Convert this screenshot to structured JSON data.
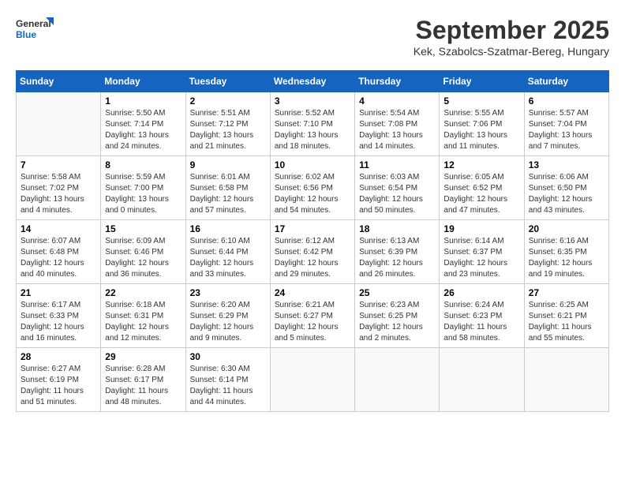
{
  "header": {
    "logo": {
      "general": "General",
      "blue": "Blue"
    },
    "title": "September 2025",
    "location": "Kek, Szabolcs-Szatmar-Bereg, Hungary"
  },
  "calendar": {
    "weekdays": [
      "Sunday",
      "Monday",
      "Tuesday",
      "Wednesday",
      "Thursday",
      "Friday",
      "Saturday"
    ],
    "rows": [
      [
        {
          "day": "",
          "empty": true
        },
        {
          "day": "1",
          "sunrise": "5:50 AM",
          "sunset": "7:14 PM",
          "daylight": "13 hours and 24 minutes."
        },
        {
          "day": "2",
          "sunrise": "5:51 AM",
          "sunset": "7:12 PM",
          "daylight": "13 hours and 21 minutes."
        },
        {
          "day": "3",
          "sunrise": "5:52 AM",
          "sunset": "7:10 PM",
          "daylight": "13 hours and 18 minutes."
        },
        {
          "day": "4",
          "sunrise": "5:54 AM",
          "sunset": "7:08 PM",
          "daylight": "13 hours and 14 minutes."
        },
        {
          "day": "5",
          "sunrise": "5:55 AM",
          "sunset": "7:06 PM",
          "daylight": "13 hours and 11 minutes."
        },
        {
          "day": "6",
          "sunrise": "5:57 AM",
          "sunset": "7:04 PM",
          "daylight": "13 hours and 7 minutes."
        }
      ],
      [
        {
          "day": "7",
          "sunrise": "5:58 AM",
          "sunset": "7:02 PM",
          "daylight": "13 hours and 4 minutes."
        },
        {
          "day": "8",
          "sunrise": "5:59 AM",
          "sunset": "7:00 PM",
          "daylight": "13 hours and 0 minutes."
        },
        {
          "day": "9",
          "sunrise": "6:01 AM",
          "sunset": "6:58 PM",
          "daylight": "12 hours and 57 minutes."
        },
        {
          "day": "10",
          "sunrise": "6:02 AM",
          "sunset": "6:56 PM",
          "daylight": "12 hours and 54 minutes."
        },
        {
          "day": "11",
          "sunrise": "6:03 AM",
          "sunset": "6:54 PM",
          "daylight": "12 hours and 50 minutes."
        },
        {
          "day": "12",
          "sunrise": "6:05 AM",
          "sunset": "6:52 PM",
          "daylight": "12 hours and 47 minutes."
        },
        {
          "day": "13",
          "sunrise": "6:06 AM",
          "sunset": "6:50 PM",
          "daylight": "12 hours and 43 minutes."
        }
      ],
      [
        {
          "day": "14",
          "sunrise": "6:07 AM",
          "sunset": "6:48 PM",
          "daylight": "12 hours and 40 minutes."
        },
        {
          "day": "15",
          "sunrise": "6:09 AM",
          "sunset": "6:46 PM",
          "daylight": "12 hours and 36 minutes."
        },
        {
          "day": "16",
          "sunrise": "6:10 AM",
          "sunset": "6:44 PM",
          "daylight": "12 hours and 33 minutes."
        },
        {
          "day": "17",
          "sunrise": "6:12 AM",
          "sunset": "6:42 PM",
          "daylight": "12 hours and 29 minutes."
        },
        {
          "day": "18",
          "sunrise": "6:13 AM",
          "sunset": "6:39 PM",
          "daylight": "12 hours and 26 minutes."
        },
        {
          "day": "19",
          "sunrise": "6:14 AM",
          "sunset": "6:37 PM",
          "daylight": "12 hours and 23 minutes."
        },
        {
          "day": "20",
          "sunrise": "6:16 AM",
          "sunset": "6:35 PM",
          "daylight": "12 hours and 19 minutes."
        }
      ],
      [
        {
          "day": "21",
          "sunrise": "6:17 AM",
          "sunset": "6:33 PM",
          "daylight": "12 hours and 16 minutes."
        },
        {
          "day": "22",
          "sunrise": "6:18 AM",
          "sunset": "6:31 PM",
          "daylight": "12 hours and 12 minutes."
        },
        {
          "day": "23",
          "sunrise": "6:20 AM",
          "sunset": "6:29 PM",
          "daylight": "12 hours and 9 minutes."
        },
        {
          "day": "24",
          "sunrise": "6:21 AM",
          "sunset": "6:27 PM",
          "daylight": "12 hours and 5 minutes."
        },
        {
          "day": "25",
          "sunrise": "6:23 AM",
          "sunset": "6:25 PM",
          "daylight": "12 hours and 2 minutes."
        },
        {
          "day": "26",
          "sunrise": "6:24 AM",
          "sunset": "6:23 PM",
          "daylight": "11 hours and 58 minutes."
        },
        {
          "day": "27",
          "sunrise": "6:25 AM",
          "sunset": "6:21 PM",
          "daylight": "11 hours and 55 minutes."
        }
      ],
      [
        {
          "day": "28",
          "sunrise": "6:27 AM",
          "sunset": "6:19 PM",
          "daylight": "11 hours and 51 minutes."
        },
        {
          "day": "29",
          "sunrise": "6:28 AM",
          "sunset": "6:17 PM",
          "daylight": "11 hours and 48 minutes."
        },
        {
          "day": "30",
          "sunrise": "6:30 AM",
          "sunset": "6:14 PM",
          "daylight": "11 hours and 44 minutes."
        },
        {
          "day": "",
          "empty": true
        },
        {
          "day": "",
          "empty": true
        },
        {
          "day": "",
          "empty": true
        },
        {
          "day": "",
          "empty": true
        }
      ]
    ]
  }
}
